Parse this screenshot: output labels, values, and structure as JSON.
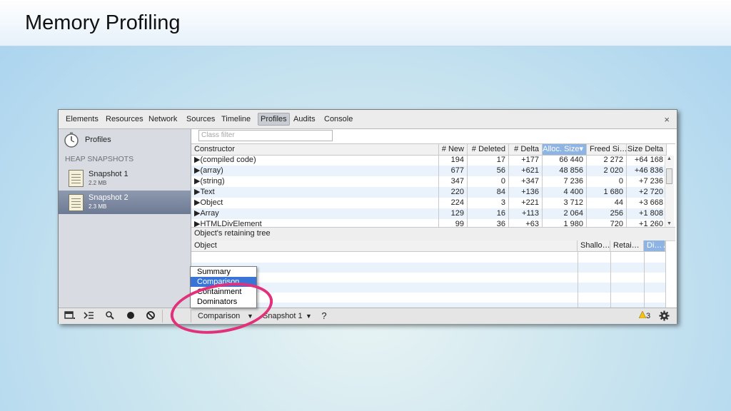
{
  "slide": {
    "title": "Memory Profiling"
  },
  "colors": {
    "accent": "#8db4e2",
    "annotation": "#e0317a",
    "selection": "#3875d7"
  },
  "tabs": [
    "Elements",
    "Resources",
    "Network",
    "Sources",
    "Timeline",
    "Profiles",
    "Audits",
    "Console"
  ],
  "selected_tab": "Profiles",
  "window_close": "×",
  "sidebar": {
    "profiles_label": "Profiles",
    "section_label": "HEAP SNAPSHOTS",
    "snapshots": [
      {
        "name": "Snapshot 1",
        "size": "2.2 MB"
      },
      {
        "name": "Snapshot 2",
        "size": "2.3 MB"
      }
    ]
  },
  "filter": {
    "placeholder": "Class filter"
  },
  "table": {
    "headers": [
      "Constructor",
      "# New",
      "# Deleted",
      "# Delta",
      "Alloc. Size▾",
      "Freed Si…",
      "Size Delta"
    ],
    "rows": [
      [
        "▶(compiled code)",
        "194",
        "17",
        "+177",
        "66 440",
        "2 272",
        "+64 168"
      ],
      [
        "▶(array)",
        "677",
        "56",
        "+621",
        "48 856",
        "2 020",
        "+46 836"
      ],
      [
        "▶(string)",
        "347",
        "0",
        "+347",
        "7 236",
        "0",
        "+7 236"
      ],
      [
        "▶Text",
        "220",
        "84",
        "+136",
        "4 400",
        "1 680",
        "+2 720"
      ],
      [
        "▶Object",
        "224",
        "3",
        "+221",
        "3 712",
        "44",
        "+3 668"
      ],
      [
        "▶Array",
        "129",
        "16",
        "+113",
        "2 064",
        "256",
        "+1 808"
      ],
      [
        "▶HTMLDivElement",
        "99",
        "36",
        "+63",
        "1 980",
        "720",
        "+1 260"
      ]
    ]
  },
  "retaining": {
    "title": "Object's retaining tree",
    "headers": [
      "Object",
      "Shallo…",
      "Retai…",
      "Di…▲"
    ]
  },
  "bottom": {
    "view_select": "Comparison",
    "base_select": "Snapshot 1",
    "help": "?",
    "warning_count": "3",
    "dropdown_arrow": "▼"
  },
  "dropdown_options": [
    "Summary",
    "Comparison",
    "Containment",
    "Dominators"
  ],
  "dropdown_highlighted": "Comparison"
}
